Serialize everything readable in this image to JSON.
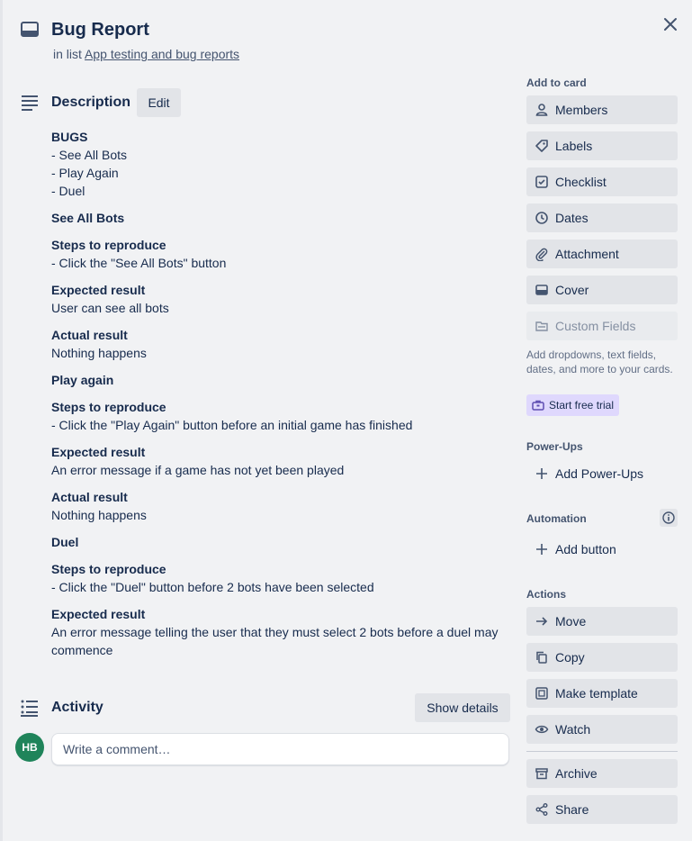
{
  "card": {
    "title": "Bug Report",
    "in_list_prefix": "in list",
    "list_name": "App testing and bug reports"
  },
  "description": {
    "heading": "Description",
    "edit_label": "Edit",
    "blocks": [
      {
        "bold": "BUGS",
        "lines": [
          "- See All Bots",
          "- Play Again",
          "- Duel"
        ]
      },
      {
        "bold": "See All Bots",
        "lines": []
      },
      {
        "bold": "Steps to reproduce",
        "lines": [
          "- Click the \"See All Bots\" button"
        ]
      },
      {
        "bold": "Expected result",
        "lines": [
          "User can see all bots"
        ]
      },
      {
        "bold": "Actual result",
        "lines": [
          "Nothing happens"
        ]
      },
      {
        "bold": "Play again",
        "lines": []
      },
      {
        "bold": "Steps to reproduce",
        "lines": [
          "- Click the \"Play Again\" button before an initial game has finished"
        ]
      },
      {
        "bold": "Expected result",
        "lines": [
          "An error message if a game has not yet been played"
        ]
      },
      {
        "bold": "Actual result",
        "lines": [
          "Nothing happens"
        ]
      },
      {
        "bold": "Duel",
        "lines": []
      },
      {
        "bold": "Steps to reproduce",
        "lines": [
          "- Click the \"Duel\" button before 2 bots have been selected"
        ]
      },
      {
        "bold": "Expected result",
        "lines": [
          "An error message telling the user that they must select 2 bots before a duel may commence"
        ]
      }
    ]
  },
  "activity": {
    "heading": "Activity",
    "show_details_label": "Show details",
    "avatar_initials": "HB",
    "comment_placeholder": "Write a comment…"
  },
  "sidebar": {
    "add_to_card_heading": "Add to card",
    "add_to_card": [
      {
        "label": "Members",
        "icon": "person-icon"
      },
      {
        "label": "Labels",
        "icon": "tag-icon"
      },
      {
        "label": "Checklist",
        "icon": "checkbox-icon"
      },
      {
        "label": "Dates",
        "icon": "clock-icon"
      },
      {
        "label": "Attachment",
        "icon": "paperclip-icon"
      },
      {
        "label": "Cover",
        "icon": "cover-icon"
      },
      {
        "label": "Custom Fields",
        "icon": "custom-fields-icon"
      }
    ],
    "custom_fields_desc": "Add dropdowns, text fields, dates, and more to your cards.",
    "trial_label": "Start free trial",
    "powerups_heading": "Power-Ups",
    "add_powerups_label": "Add Power-Ups",
    "automation_heading": "Automation",
    "add_button_label": "Add button",
    "actions_heading": "Actions",
    "actions": [
      {
        "label": "Move",
        "icon": "arrow-right-icon"
      },
      {
        "label": "Copy",
        "icon": "copy-icon"
      },
      {
        "label": "Make template",
        "icon": "template-icon"
      },
      {
        "label": "Watch",
        "icon": "eye-icon"
      }
    ],
    "archive_label": "Archive",
    "share_label": "Share"
  },
  "colors": {
    "background": "#f1f2f4",
    "button": "#e2e4e8",
    "avatar": "#1f845a",
    "trial_badge": "#dfd8fd",
    "text": "#172b4d"
  }
}
